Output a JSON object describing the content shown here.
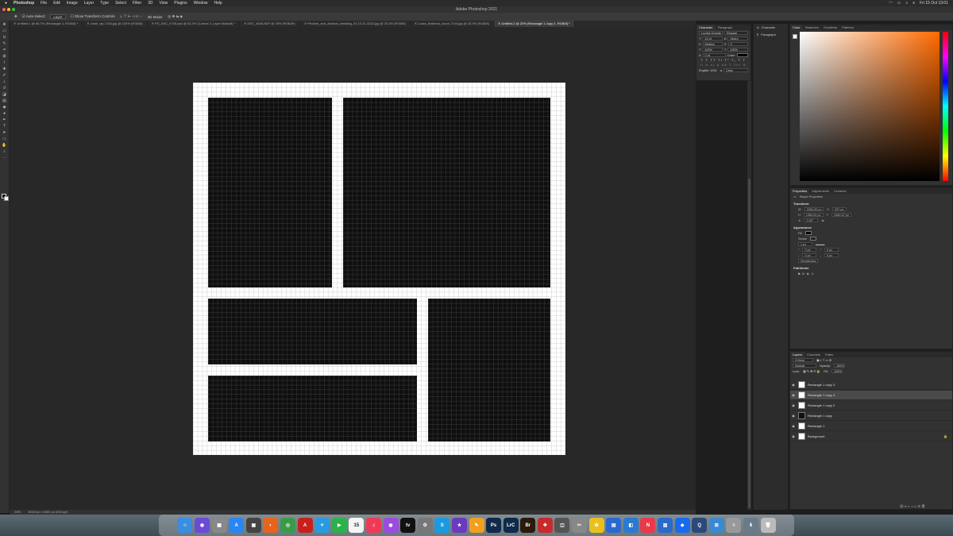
{
  "menubar": {
    "app": "Photoshop",
    "items": [
      "File",
      "Edit",
      "Image",
      "Layer",
      "Type",
      "Select",
      "Filter",
      "3D",
      "View",
      "Plugins",
      "Window",
      "Help"
    ],
    "clock": "Fri 15 Oct  13:01"
  },
  "window_title": "Adobe Photoshop 2021",
  "options": {
    "auto_select": "Auto-Select:",
    "layer_mode": "Layer",
    "show_transform": "Show Transform Controls",
    "mode_3d": "3D Mode:"
  },
  "tabs": [
    {
      "label": "Untitled-1 @ 66.7% (Rectangle 4, RGB/8) *",
      "active": false
    },
    {
      "label": "clone_wp-7184.jpg @ 100% (RGB/8)",
      "active": false
    },
    {
      "label": "PS_DSC_5745.psd @ 33.3% (Curves 3, Layer Mask/8) *",
      "active": false
    },
    {
      "label": "DSC_4606.NEF @ 25% (RGB/8*)",
      "active": false
    },
    {
      "label": "Phoebe_and_Andrew_wedding_01.10.21-3222.jpg @ 33.3% (RGB/8)",
      "active": false
    },
    {
      "label": "Laura_blubbers_clone-7104.jpg @ 33.3% (RGB/8)",
      "active": false
    },
    {
      "label": "Untitled-2 @ 25% (Rectangle 1 copy 4, RGB/8) *",
      "active": true
    }
  ],
  "status": {
    "zoom": "25%",
    "doc_size": "6000 px x 6000 px (300 ppi)"
  },
  "character": {
    "tabs": [
      "Character",
      "Paragraph"
    ],
    "font": "Lucida Grande",
    "style": "Regular",
    "size": "12 pt",
    "leading": "(Auto)",
    "kerning": "Metrics",
    "tracking": "0",
    "vscale": "100%",
    "hscale": "100%",
    "baseline": "0 pt",
    "color_label": "Color:",
    "language": "English: USA",
    "aa_prefix": "a",
    "aa": "Crisp"
  },
  "mini": [
    {
      "icon": "A",
      "label": "Character"
    },
    {
      "icon": "¶",
      "label": "Paragraph"
    }
  ],
  "color_panel": {
    "tabs": [
      "Color",
      "Swatches",
      "Gradients",
      "Patterns"
    ]
  },
  "properties": {
    "tabs": [
      "Properties",
      "Adjustments",
      "Libraries"
    ],
    "kind": "Shape Properties",
    "transform_title": "Transform",
    "w": "3354.00 px",
    "x": "237 px",
    "h": "1984.00 px",
    "y": "2460.67 px",
    "angle": "0.00°",
    "appearance_title": "Appearance",
    "fill_label": "Fill",
    "stroke_label": "Stroke",
    "stroke_width": "1 px",
    "corner1": "0 px",
    "corner2": "0 px",
    "corner3": "0 px",
    "corner4": "0 px",
    "semicolon": "Semicircles",
    "pathfinder_title": "Pathfinder"
  },
  "layers": {
    "tabs": [
      "Layers",
      "Channels",
      "Paths"
    ],
    "kind": "Q Kind",
    "blend": "Normal",
    "opacity_label": "Opacity:",
    "opacity": "100%",
    "lock_label": "Lock:",
    "fill_label": "Fill:",
    "fill": "100%",
    "items": [
      {
        "name": "Rectangle 1 copy 3",
        "selected": false,
        "dark": false
      },
      {
        "name": "Rectangle 1 copy 4",
        "selected": true,
        "dark": false
      },
      {
        "name": "Rectangle 1 copy 2",
        "selected": false,
        "dark": false
      },
      {
        "name": "Rectangle 1 copy",
        "selected": false,
        "dark": true
      },
      {
        "name": "Rectangle 1",
        "selected": false,
        "dark": false
      },
      {
        "name": "Background",
        "selected": false,
        "dark": false
      }
    ]
  },
  "dock": {
    "calendar_day": "15",
    "items": [
      {
        "name": "finder",
        "label": "☺",
        "color": "#3a8de0"
      },
      {
        "name": "siri",
        "label": "◉",
        "color": "#6a4bd6"
      },
      {
        "name": "launchpad",
        "label": "▦",
        "color": "#888"
      },
      {
        "name": "app-store",
        "label": "A",
        "color": "#2a86f0"
      },
      {
        "name": "mission-control",
        "label": "▣",
        "color": "#444"
      },
      {
        "name": "firefox",
        "label": "◐",
        "color": "#e8641c"
      },
      {
        "name": "chrome",
        "label": "◎",
        "color": "#3b9a4a"
      },
      {
        "name": "acrobat",
        "label": "A",
        "color": "#c8201c"
      },
      {
        "name": "safari",
        "label": "✧",
        "color": "#2a9ae0"
      },
      {
        "name": "facetime",
        "label": "▶",
        "color": "#2bb24c"
      },
      {
        "name": "calendar",
        "label": "15",
        "color": "#f4f4f4"
      },
      {
        "name": "music",
        "label": "♫",
        "color": "#f03a55"
      },
      {
        "name": "podcasts",
        "label": "◉",
        "color": "#9a4ce0"
      },
      {
        "name": "apple-tv",
        "label": "tv",
        "color": "#111"
      },
      {
        "name": "system-prefs",
        "label": "⚙",
        "color": "#777"
      },
      {
        "name": "skype",
        "label": "S",
        "color": "#1a9ae0"
      },
      {
        "name": "imovie",
        "label": "★",
        "color": "#6a3ac0"
      },
      {
        "name": "pages",
        "label": "✎",
        "color": "#f0a020"
      },
      {
        "name": "photoshop",
        "label": "Ps",
        "color": "#0f2a4a"
      },
      {
        "name": "lightroom-classic",
        "label": "LrC",
        "color": "#0f2a4a"
      },
      {
        "name": "bridge",
        "label": "Br",
        "color": "#2a1a0a"
      },
      {
        "name": "flashcard",
        "label": "✚",
        "color": "#c82a2a"
      },
      {
        "name": "screenshot",
        "label": "◫",
        "color": "#555"
      },
      {
        "name": "script-editor",
        "label": "✂",
        "color": "#888"
      },
      {
        "name": "photos",
        "label": "✿",
        "color": "#e8c020"
      },
      {
        "name": "keynote",
        "label": "▤",
        "color": "#2a6ad0"
      },
      {
        "name": "preview",
        "label": "◧",
        "color": "#2a7ad0"
      },
      {
        "name": "news",
        "label": "N",
        "color": "#e83a4a"
      },
      {
        "name": "cards",
        "label": "▥",
        "color": "#2a6ac8"
      },
      {
        "name": "dropbox",
        "label": "◆",
        "color": "#1a6af0"
      },
      {
        "name": "quicktime",
        "label": "Q",
        "color": "#2a4a7a"
      },
      {
        "name": "utility",
        "label": "⊞",
        "color": "#3a8ad0"
      },
      {
        "name": "documents",
        "label": "≡",
        "color": "#999"
      },
      {
        "name": "downloads",
        "label": "⬇",
        "color": "#6a7a8a"
      },
      {
        "name": "trash",
        "label": "🗑",
        "color": "#bbb"
      }
    ]
  }
}
